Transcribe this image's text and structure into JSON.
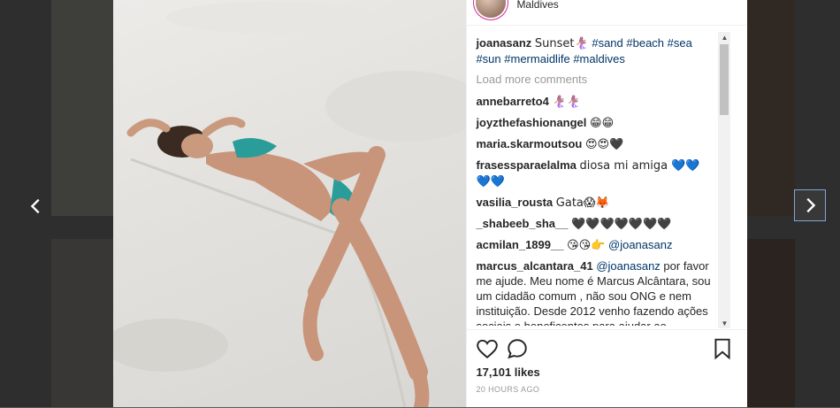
{
  "post": {
    "location": "Maldives",
    "caption": {
      "user": "joanasanz",
      "text": "Sunset🧜🏽‍♀️",
      "tags": [
        "#sand",
        "#beach",
        "#sea",
        "#sun",
        "#mermaidlife",
        "#maldives"
      ]
    },
    "load_more": "Load more comments",
    "comments": [
      {
        "user": "annebarreto4",
        "text": "🧜🏽‍♀️🧜🏽‍♀️"
      },
      {
        "user": "joyzthefashionangel",
        "text": "😁😁"
      },
      {
        "user": "maria.skarmoutsou",
        "text": "😍😍🖤"
      },
      {
        "user": "frasessparaelalma",
        "text": "diosa mi amiga 💙💙 💙💙"
      },
      {
        "user": "vasilia_rousta",
        "text": "Gata😱🦊"
      },
      {
        "user": "_shabeeb_sha__",
        "text": "🖤🖤🖤🖤🖤🖤🖤"
      },
      {
        "user": "acmilan_1899__",
        "text": "😘😘👉",
        "mention": "@joanasanz"
      },
      {
        "user": "marcus_alcantara_41",
        "mention": "@joanasanz",
        "text": "por favor me ajude. Meu nome é Marcus Alcântara, sou um cidadão comum , não sou ONG e nem instituição. Desde 2012 venho fazendo ações sociais e beneficentes para ajudar ao próximo, fazendo o bem sem"
      }
    ],
    "likes": "17,101 likes",
    "timestamp": "20 HOURS AGO"
  },
  "icons": {
    "prev": "chevron-left-icon",
    "next": "chevron-right-icon",
    "like": "heart-outline-icon",
    "comment": "comment-bubble-icon",
    "save": "bookmark-icon"
  },
  "colors": {
    "link": "#003569",
    "text": "#262626",
    "muted": "#999999",
    "swimsuit": "#2a9d9a"
  }
}
